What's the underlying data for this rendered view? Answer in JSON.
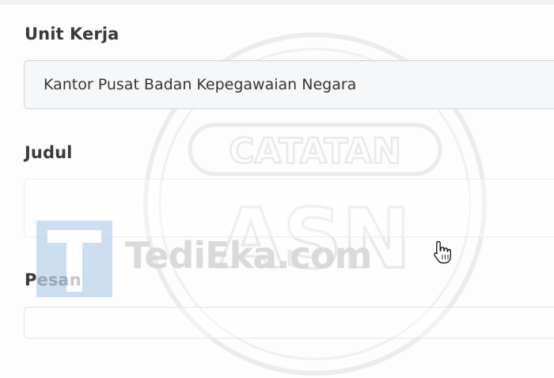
{
  "form": {
    "unit_kerja": {
      "label": "Unit Kerja",
      "value": "Kantor Pusat Badan Kepegawaian Negara"
    },
    "judul": {
      "label": "Judul",
      "value": ""
    },
    "pesan": {
      "label": "Pesan",
      "value": ""
    }
  },
  "watermark": {
    "logo_letter": "T",
    "site_text": "TediEka.com",
    "seal_text_top": "CATATAN",
    "seal_text_bottom": "ASN"
  },
  "colors": {
    "label_text": "#3a3a3a",
    "field_text": "#363636",
    "field_border": "#d2d8de",
    "field_bg_readonly": "#f6f7f8",
    "watermark_logo": "#b9d3ec",
    "watermark_text": "#d7d7d7"
  },
  "icons": {
    "cursor": "hand-pointer-cursor-icon"
  }
}
